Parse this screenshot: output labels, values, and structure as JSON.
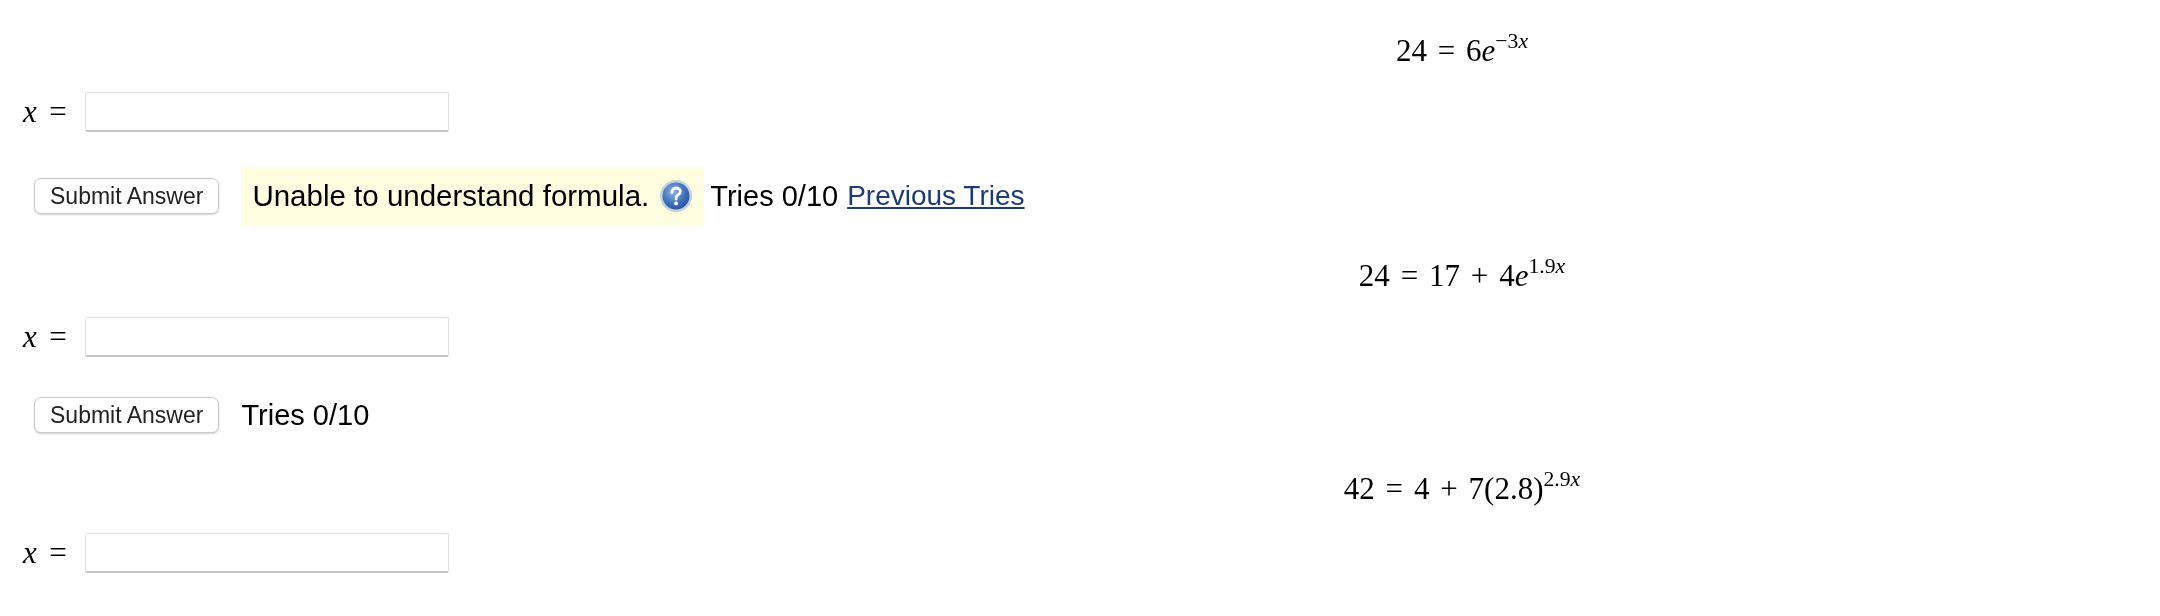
{
  "problems": [
    {
      "equation": {
        "text": "24 = 6e",
        "exponent": "−3x"
      },
      "answer": {
        "label": "*x* ="
      },
      "submit": "Submit Answer",
      "feedback": {
        "message": "Unable to understand formula.",
        "help_icon": true
      },
      "tries": "Tries 0/10",
      "previous_tries": "Previous Tries"
    },
    {
      "equation": {
        "text": "24 = 17 + 4e",
        "exponent": "1.9x"
      },
      "answer": {
        "label": "*x* ="
      },
      "submit": "Submit Answer",
      "tries": "Tries 0/10"
    },
    {
      "equation": {
        "text": "42 = 4 + 7(2.8)",
        "exponent": "2.9x"
      },
      "answer": {
        "label": "*x* ="
      }
    }
  ]
}
